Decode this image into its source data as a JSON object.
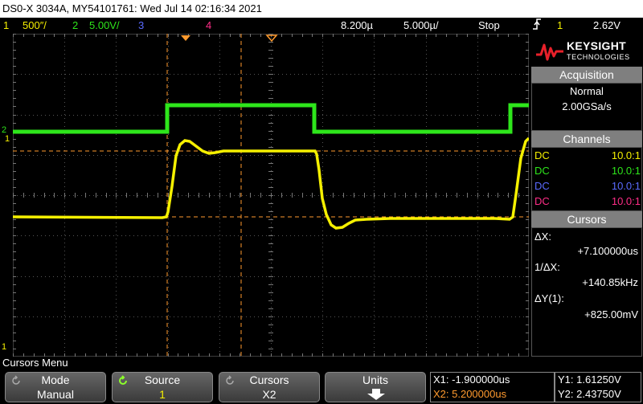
{
  "title_bar": "DS0-X 3034A, MY54101761: Wed Jul 14 02:16:34 2021",
  "status": {
    "ch1_num": "1",
    "ch1_scale": "500″/",
    "ch2_num": "2",
    "ch2_scale": "5.00V/",
    "ch3_num": "3",
    "ch4_num": "4",
    "time_pos": "8.200µ",
    "time_scale": "5.000µ/",
    "run_state": "Stop",
    "trigger_icon": "rising-edge-trigger-icon",
    "trigger_source": "1",
    "trigger_level": "2.62V"
  },
  "brand": {
    "name": "KEYSIGHT",
    "sub": "TECHNOLOGIES"
  },
  "acquisition": {
    "title": "Acquisition",
    "mode": "Normal",
    "rate": "2.00GSa/s"
  },
  "channels": {
    "title": "Channels",
    "rows": [
      {
        "coupling": "DC",
        "probe": "10.0:1",
        "color": "#f5f000"
      },
      {
        "coupling": "DC",
        "probe": "10.0:1",
        "color": "#2ee61b"
      },
      {
        "coupling": "DC",
        "probe": "10.0:1",
        "color": "#5a6bff"
      },
      {
        "coupling": "DC",
        "probe": "10.0:1",
        "color": "#ff2d87"
      }
    ]
  },
  "cursors": {
    "title": "Cursors",
    "dx_label": "ΔX:",
    "dx_value": "+7.100000us",
    "inv_label": "1/ΔX:",
    "inv_value": "+140.85kHz",
    "dy_label": "ΔY(1):",
    "dy_value": "+825.00mV"
  },
  "markers": {
    "ch2_ground": "2",
    "ch1_ground": "1",
    "ch1_trig": "1"
  },
  "menu_title": "Cursors Menu",
  "softkeys": [
    {
      "title": "Mode",
      "value": "Manual"
    },
    {
      "title": "Source",
      "value": "1"
    },
    {
      "title": "Cursors",
      "value": "X2"
    },
    {
      "title": "Units",
      "value": ""
    }
  ],
  "readout": {
    "x1": "X1: -1.900000us",
    "x2": "X2: 5.200000us",
    "y1": "Y1: 1.61250V",
    "y2": "Y2: 2.43750V"
  },
  "colors": {
    "ch1": "#f5f000",
    "ch2": "#2ee61b",
    "ch3": "#5a6bff",
    "ch4": "#ff2d87",
    "cursor": "#ff9a2e"
  }
}
